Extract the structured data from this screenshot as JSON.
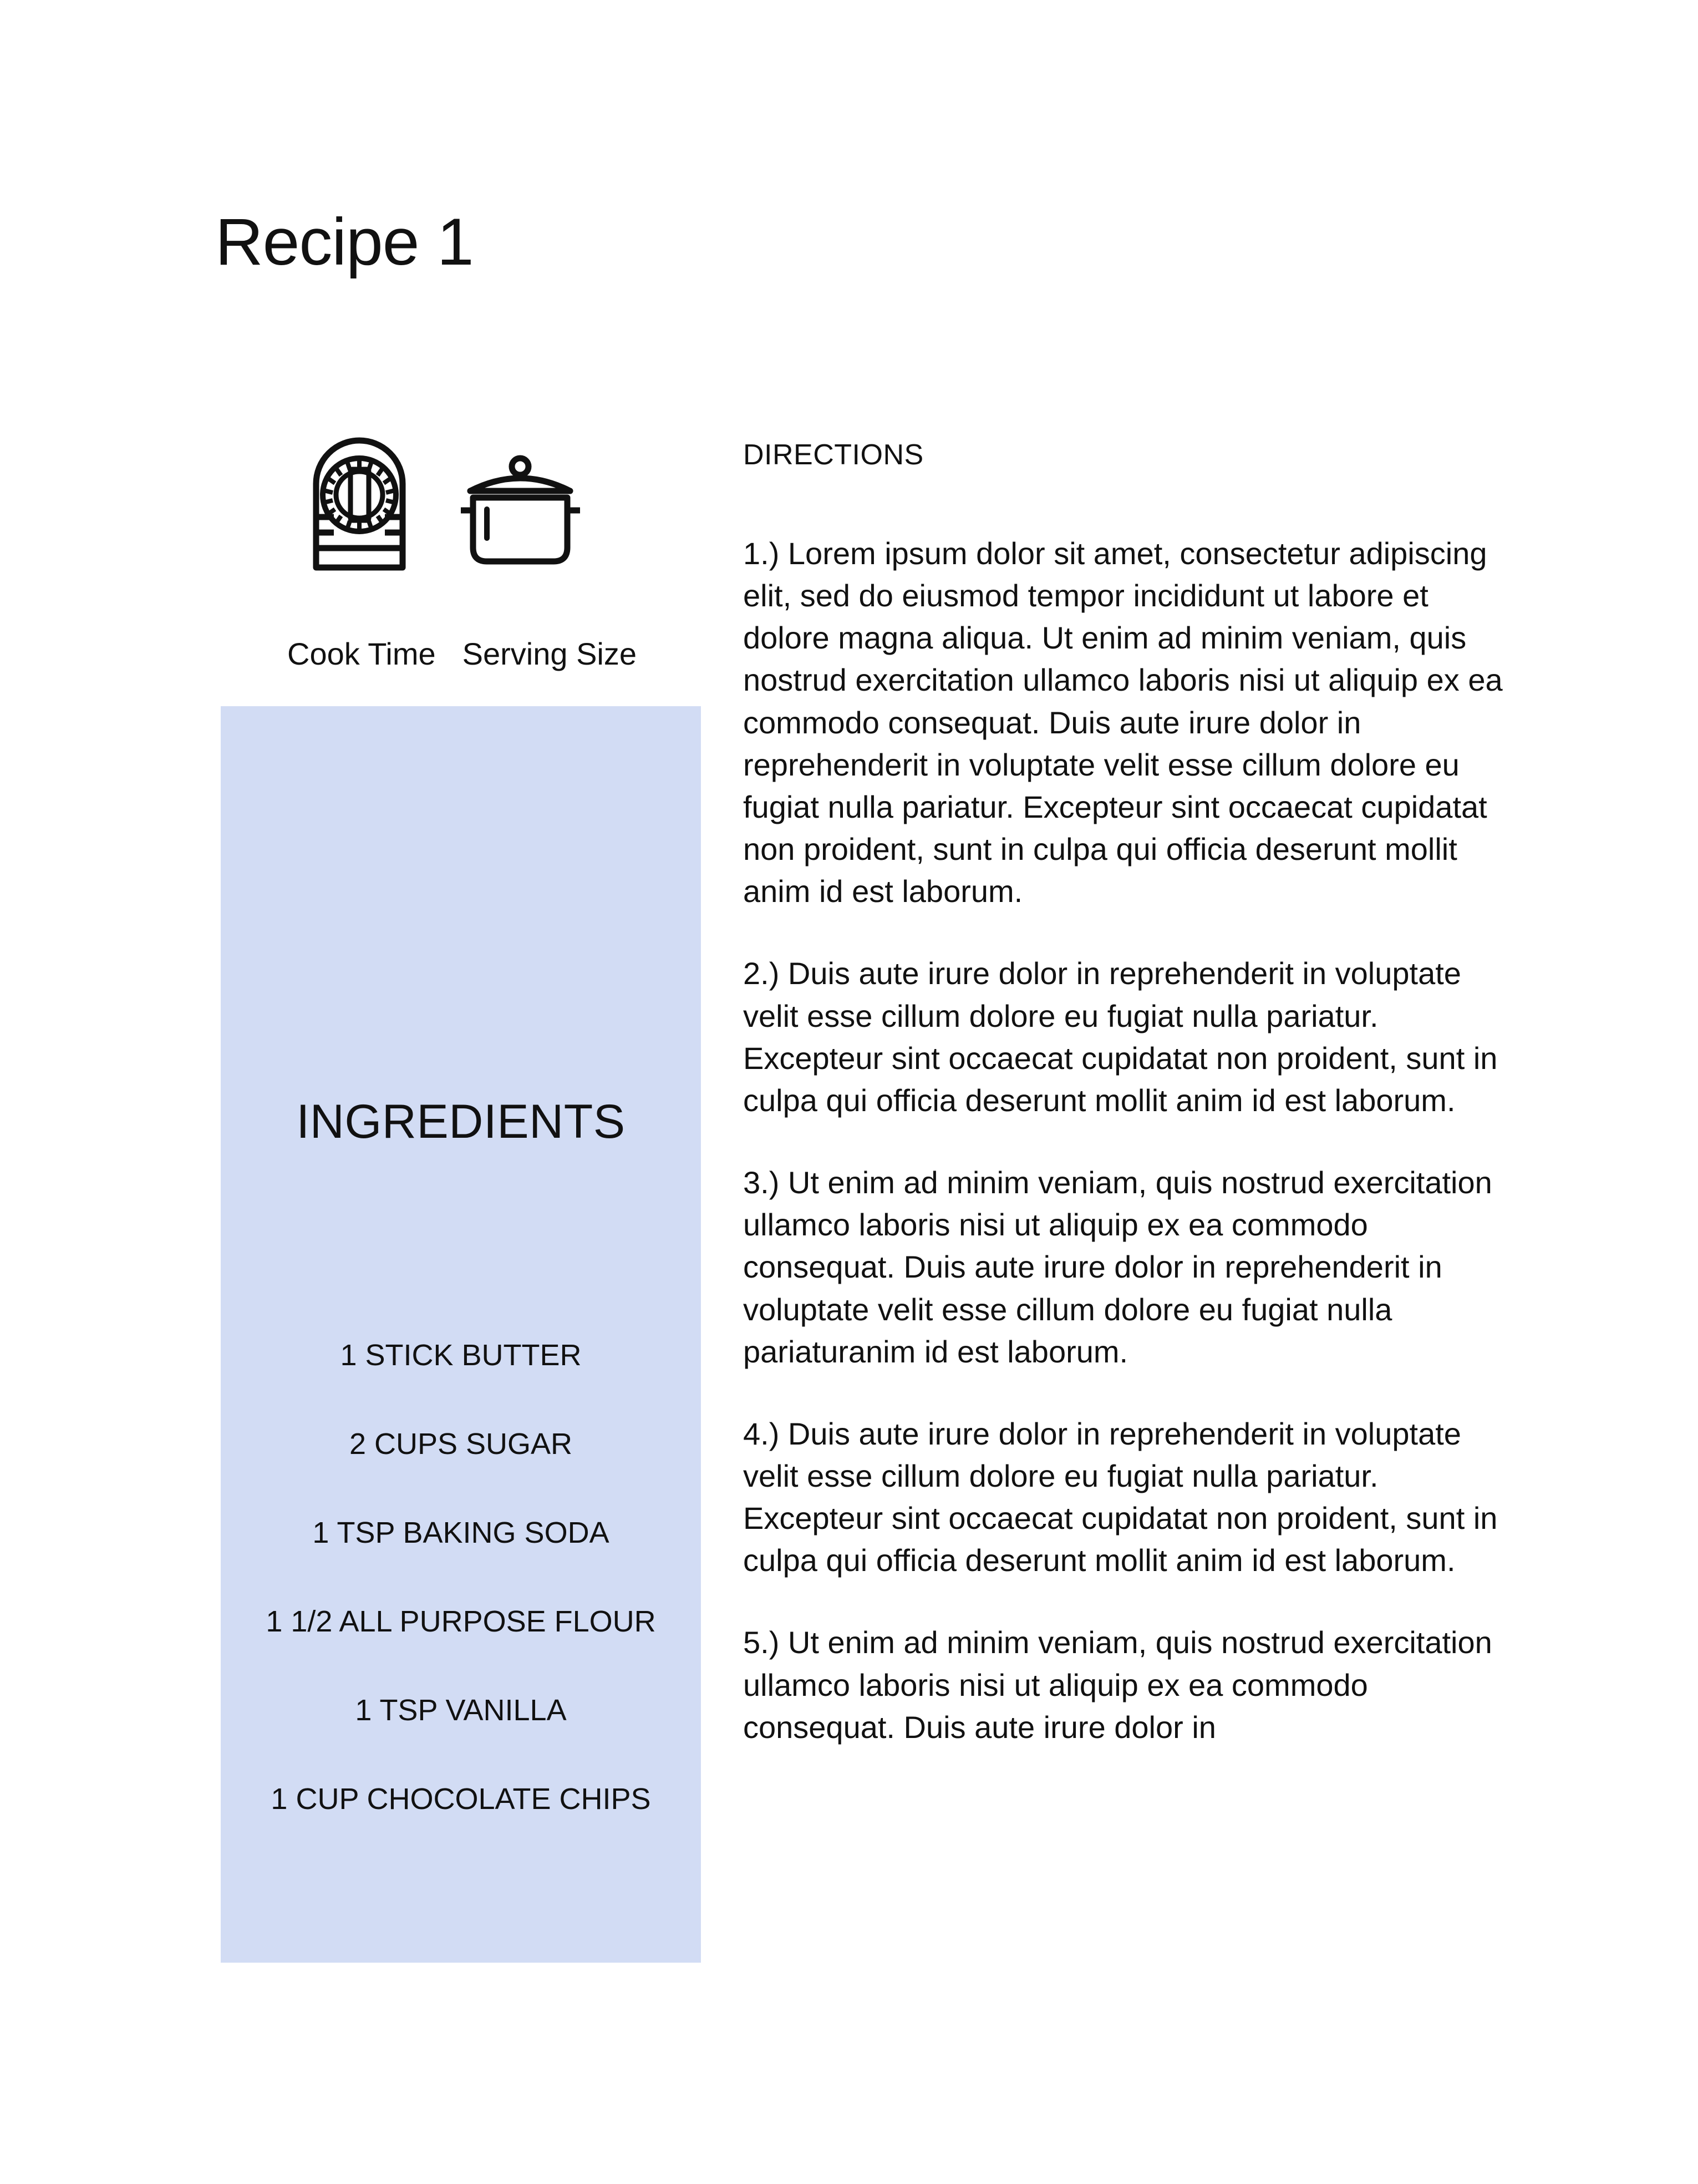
{
  "document": {
    "title": "Recipe 1"
  },
  "meta": {
    "items": [
      {
        "icon": "kitchen-timer-icon",
        "label": "Cook Time"
      },
      {
        "icon": "cooking-pot-icon",
        "label": "Serving Size"
      }
    ]
  },
  "ingredients": {
    "heading": "INGREDIENTS",
    "items": [
      "1 STICK BUTTER",
      "2 CUPS SUGAR",
      "1 TSP BAKING SODA",
      "1 1/2 ALL PURPOSE FLOUR",
      "1 TSP VANILLA",
      "1 CUP CHOCOLATE CHIPS"
    ]
  },
  "directions": {
    "heading": "DIRECTIONS",
    "steps": [
      "1.) Lorem ipsum dolor sit amet, consectetur adipiscing elit, sed do eiusmod tempor incididunt ut labore et dolore magna aliqua. Ut enim ad minim veniam, quis nostrud exercitation ullamco laboris nisi ut aliquip ex ea commodo consequat. Duis aute irure dolor in reprehenderit in voluptate velit esse cillum dolore eu fugiat nulla pariatur. Excepteur sint occaecat cupidatat non proident, sunt in culpa qui officia deserunt mollit anim id est laborum.",
      "2.) Duis aute irure dolor in reprehenderit in voluptate velit esse cillum dolore eu fugiat nulla pariatur. Excepteur sint occaecat cupidatat non proident, sunt in culpa qui officia deserunt mollit anim id est laborum.",
      "3.) Ut enim ad minim veniam, quis nostrud exercitation ullamco laboris nisi ut aliquip ex ea commodo consequat. Duis aute irure dolor in reprehenderit in voluptate velit esse cillum dolore eu fugiat nulla pariaturanim id est laborum.",
      "4.) Duis aute irure dolor in reprehenderit in voluptate velit esse cillum dolore eu fugiat nulla pariatur. Excepteur sint occaecat cupidatat non proident, sunt in culpa qui officia deserunt mollit anim id est laborum.",
      "5.) Ut enim ad minim veniam, quis nostrud exercitation ullamco laboris nisi ut aliquip ex ea commodo consequat. Duis aute irure dolor in"
    ]
  },
  "colors": {
    "panel_background": "#d2dcf4",
    "page_background": "#ffffff",
    "text": "#111111"
  }
}
